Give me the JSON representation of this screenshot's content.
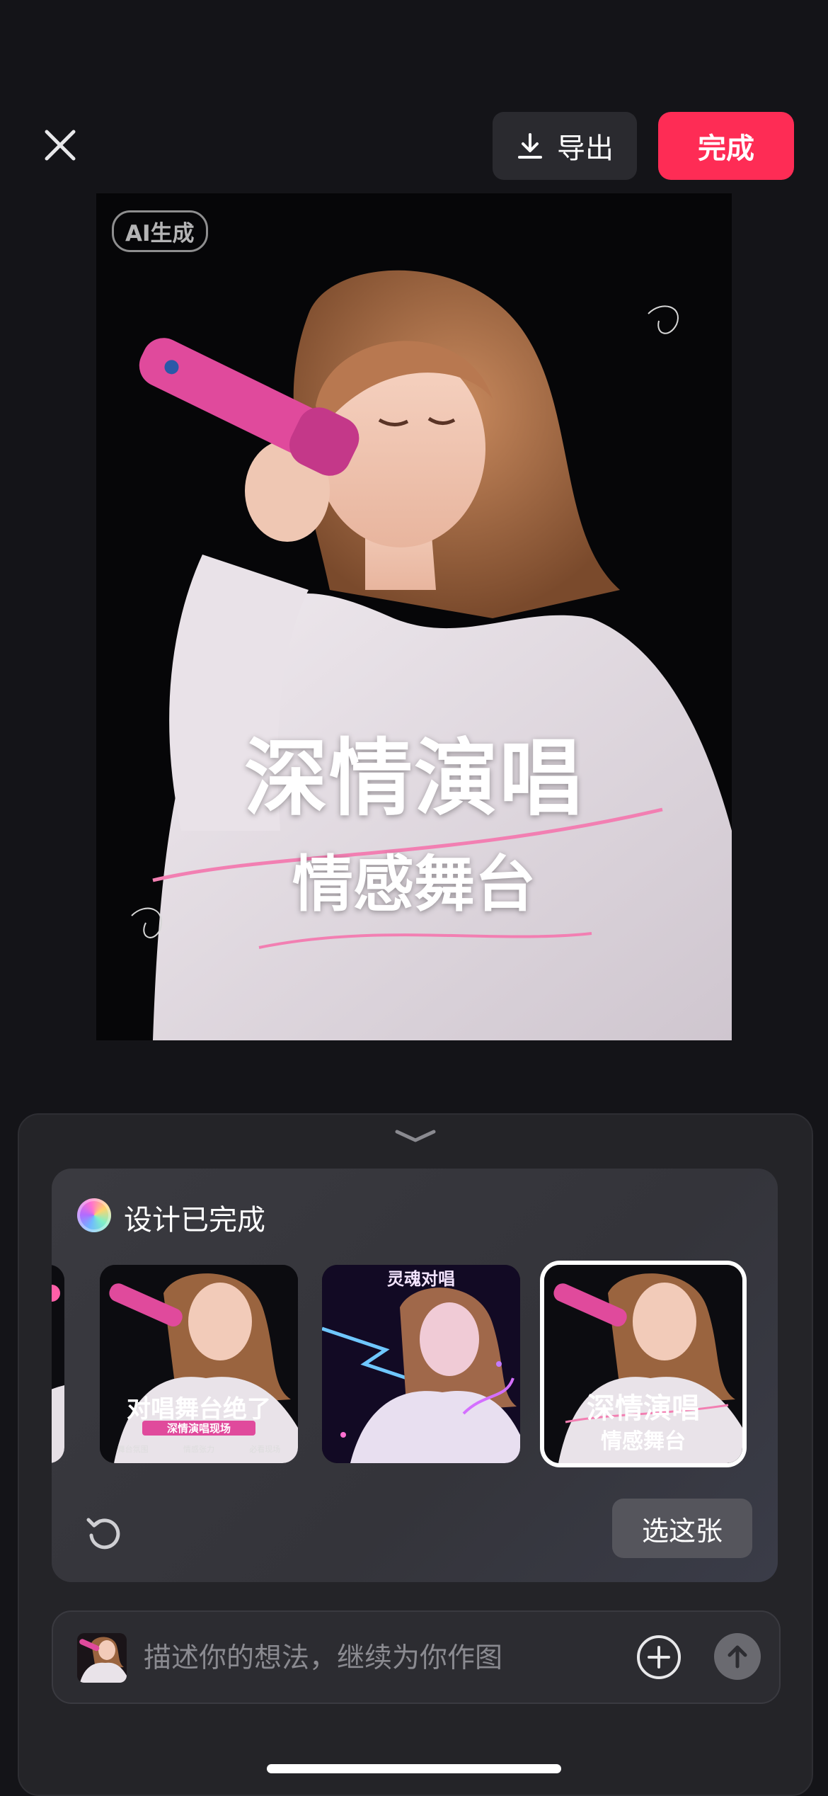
{
  "toolbar": {
    "export_label": "导出",
    "done_label": "完成"
  },
  "preview": {
    "ai_badge": "AI生成",
    "title_line1": "深情演唱",
    "title_line2": "情感舞台"
  },
  "panel": {
    "status_text": "设计已完成",
    "thumbnails": [
      {
        "title": "对唱舞台绝了",
        "subtitle": "深情演唱现场",
        "tags": [
          "舞台氛围",
          "情感张力",
          "必看现场"
        ]
      },
      {
        "title": "灵魂对唱"
      },
      {
        "title_line1": "深情演唱",
        "title_line2": "情感舞台",
        "selected": true
      }
    ],
    "pick_label": "选这张"
  },
  "composer": {
    "placeholder": "描述你的想法，继续为你作图"
  },
  "colors": {
    "accent": "#fe2c55",
    "background": "#141418",
    "sheet": "#242428"
  },
  "icons": {
    "close": "close-icon",
    "export": "download-icon",
    "collapse": "chevron-down-icon",
    "refresh": "refresh-icon",
    "add": "plus-circle-icon",
    "send": "arrow-up-icon"
  }
}
